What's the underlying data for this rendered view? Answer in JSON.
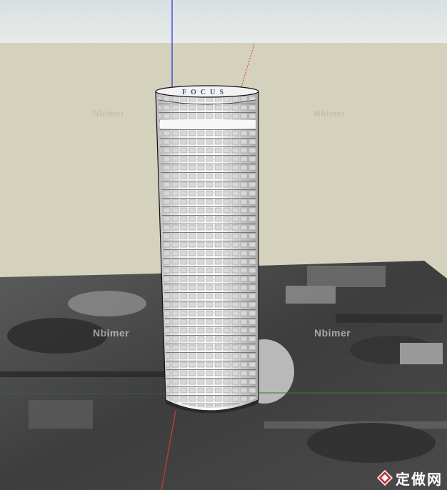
{
  "scene": {
    "building_sign": "FOCUS",
    "watermarks": [
      "Nbimer",
      "Nbimer",
      "Nbimer",
      "Nbimer"
    ],
    "logo_text": "定做网",
    "axis_colors": {
      "blue": "#2b2bd6",
      "red": "#d23b2b",
      "green": "#1f8a2a"
    },
    "sky_color": "#e3e8e8",
    "ground_color": "#d4d1bd"
  }
}
